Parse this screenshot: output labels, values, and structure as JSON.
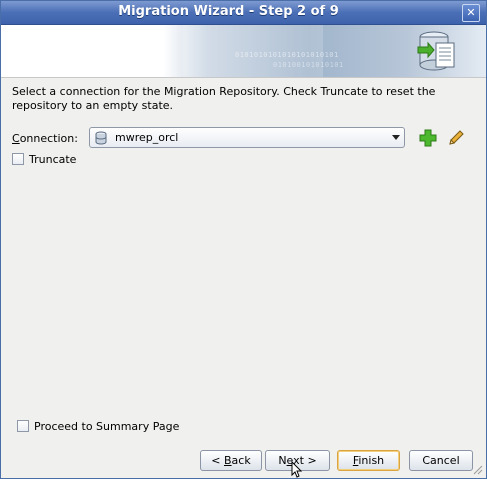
{
  "window": {
    "title": "Migration Wizard - Step 2 of 9",
    "close_glyph": "✕"
  },
  "banner": {
    "binary_text_1": "0101010101010101010101",
    "binary_text_2": "010100101010101"
  },
  "content": {
    "instruction": "Select a connection for the Migration Repository.  Check Truncate to reset the repository to an empty state.",
    "connection": {
      "label_prefix": "C",
      "label_rest": "onnection:",
      "selected_value": "mwrep_orcl"
    },
    "truncate": {
      "label": "Truncate",
      "checked": false
    },
    "proceed_summary": {
      "label": "Proceed to Summary Page",
      "checked": false
    }
  },
  "footer": {
    "back": {
      "prefix": "< ",
      "mnemonic": "B",
      "rest": "ack"
    },
    "next": {
      "prefix": "N",
      "mnemonic": "e",
      "rest": "xt >"
    },
    "finish": {
      "mnemonic": "F",
      "rest": "inish"
    },
    "cancel": {
      "label": "Cancel"
    }
  },
  "icons": {
    "wizard": "database-wizard-icon",
    "connection": "database-icon",
    "add": "plus-icon",
    "edit": "pencil-icon"
  }
}
